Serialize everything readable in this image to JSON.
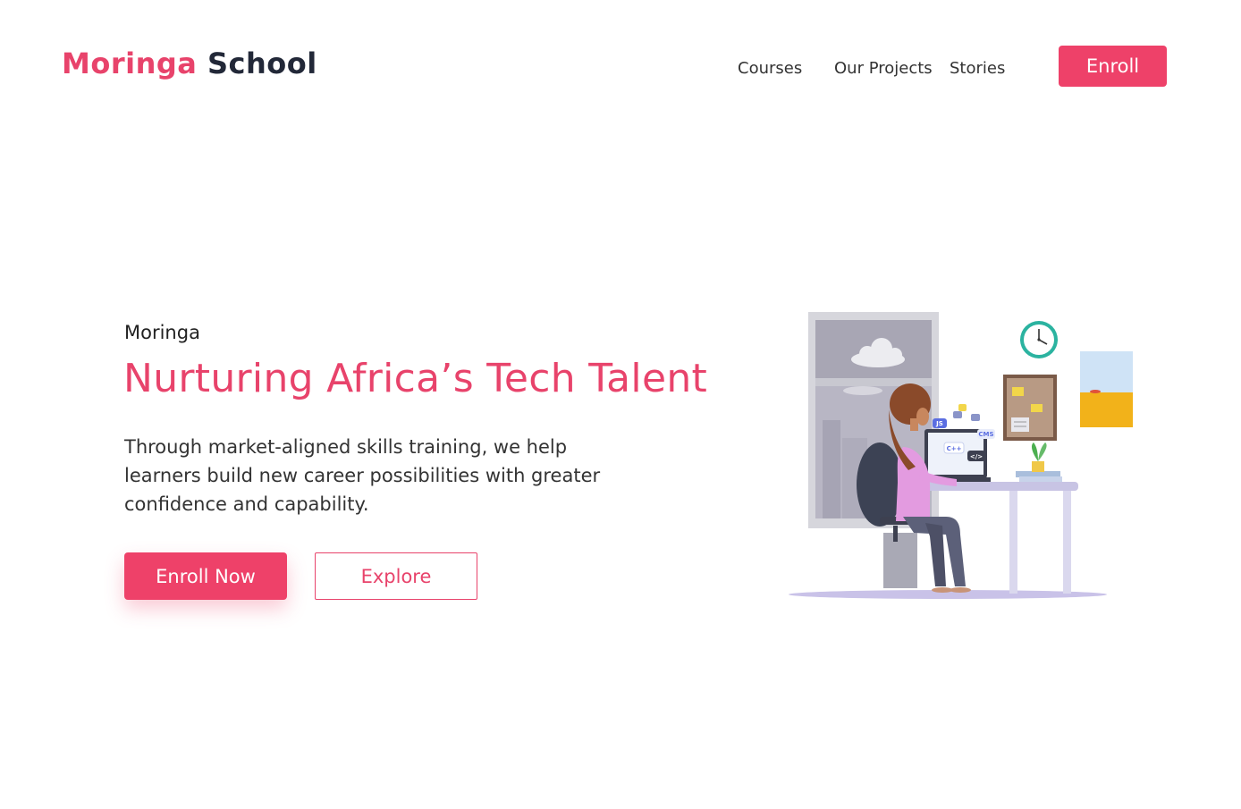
{
  "header": {
    "logo_brand": "Moringa",
    "logo_rest": "School",
    "nav": [
      "Courses",
      "Our Projects",
      "Stories"
    ],
    "enroll_label": "Enroll"
  },
  "hero": {
    "eyebrow": "Moringa",
    "headline": "Nurturing Africa’s Tech Talent",
    "description": "Through market-aligned skills training, we help learners build new career possibilities with greater confidence and capability.",
    "primary_button": "Enroll Now",
    "secondary_button": "Explore"
  },
  "illustration": {
    "laptop_tags": [
      "JS",
      "C++",
      "CMS",
      "</>"
    ]
  },
  "colors": {
    "accent": "#ee4169",
    "brand_text": "#e8436b",
    "dark": "#222838"
  }
}
